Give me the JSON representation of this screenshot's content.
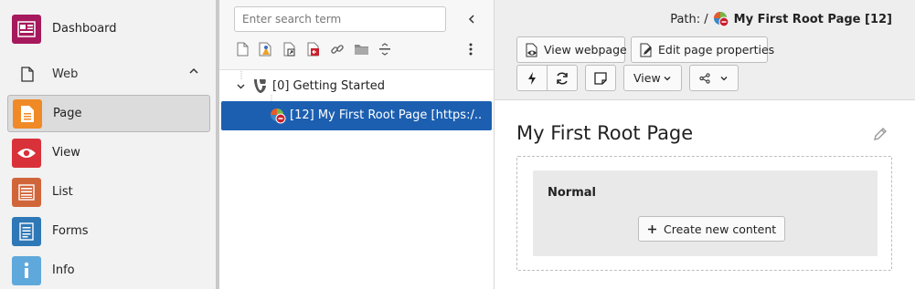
{
  "module_menu": {
    "items": [
      {
        "label": "Dashboard",
        "icon": "dashboard-icon",
        "color": "#a6195c"
      },
      {
        "label": "Web",
        "icon": "document-icon",
        "group": true
      },
      {
        "label": "Page",
        "icon": "page-icon",
        "color": "#f08a26",
        "active": true
      },
      {
        "label": "View",
        "icon": "eye-icon",
        "color": "#d9313a"
      },
      {
        "label": "List",
        "icon": "list-icon",
        "color": "#d1653a"
      },
      {
        "label": "Forms",
        "icon": "forms-icon",
        "color": "#2e78b7"
      },
      {
        "label": "Info",
        "icon": "info-icon",
        "color": "#5fa8dc"
      }
    ]
  },
  "page_tree": {
    "search_placeholder": "Enter search term",
    "toolbar_icons": [
      "new-page-icon",
      "page-template-icon",
      "page-shortcut-icon",
      "page-mountpoint-icon",
      "link-icon",
      "folder-icon",
      "divider-icon"
    ],
    "nodes": [
      {
        "label": "[0] Getting Started",
        "icon": "typo3-icon"
      },
      {
        "label": "[12] My First Root Page [https:/...",
        "icon": "root-page-icon",
        "selected": true
      }
    ]
  },
  "docheader": {
    "path_label": "Path: /",
    "path_page": "My First Root Page [12]",
    "view_webpage_label": "View webpage",
    "edit_page_label": "Edit page properties",
    "view_dropdown_label": "View"
  },
  "content": {
    "page_title": "My First Root Page",
    "column_title": "Normal",
    "new_content_label": "Create new content"
  },
  "colors": {
    "selected_node_bg": "#1c5fb1",
    "sidebar_bg": "#f2f2f2"
  }
}
